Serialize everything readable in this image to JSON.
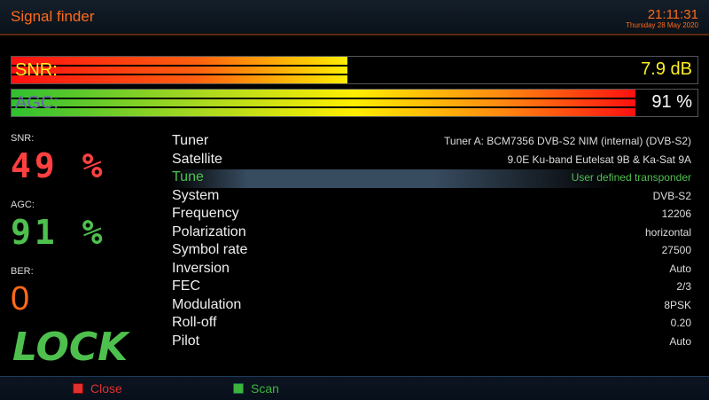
{
  "header": {
    "title": "Signal finder",
    "time": "21:11:31",
    "date": "Thursday 28 May 2020"
  },
  "bars": {
    "snr": {
      "label": "SNR:",
      "value": "7.9 dB",
      "fill_fraction": 0.49
    },
    "agc": {
      "label": "AGC:",
      "value": "91 %",
      "fill_fraction": 0.91
    }
  },
  "side": {
    "snr_label": "SNR:",
    "snr_value": "49 %",
    "agc_label": "AGC:",
    "agc_value": "91 %",
    "ber_label": "BER:",
    "ber_value": "0",
    "lock": "LOCK"
  },
  "info": [
    {
      "key": "Tuner",
      "value": "Tuner A: BCM7356 DVB-S2 NIM (internal) (DVB-S2)"
    },
    {
      "key": "Satellite",
      "value": "9.0E Ku-band Eutelsat 9B & Ka-Sat 9A"
    },
    {
      "key": "Tune",
      "value": "User defined transponder"
    },
    {
      "key": "System",
      "value": "DVB-S2"
    },
    {
      "key": "Frequency",
      "value": "12206"
    },
    {
      "key": "Polarization",
      "value": "horizontal"
    },
    {
      "key": "Symbol rate",
      "value": "27500"
    },
    {
      "key": "Inversion",
      "value": "Auto"
    },
    {
      "key": "FEC",
      "value": "2/3"
    },
    {
      "key": "Modulation",
      "value": "8PSK"
    },
    {
      "key": "Roll-off",
      "value": "0.20"
    },
    {
      "key": "Pilot",
      "value": "Auto"
    }
  ],
  "footer": {
    "close": "Close",
    "scan": "Scan"
  },
  "colors": {
    "accent": "#ff6a1a",
    "snr_value": "#ff4040",
    "agc_value": "#4ec04e",
    "ber_value": "#ff6a1a",
    "selected": "#4fc04f",
    "red_key": "#e03030",
    "green_key": "#3cb43c"
  }
}
